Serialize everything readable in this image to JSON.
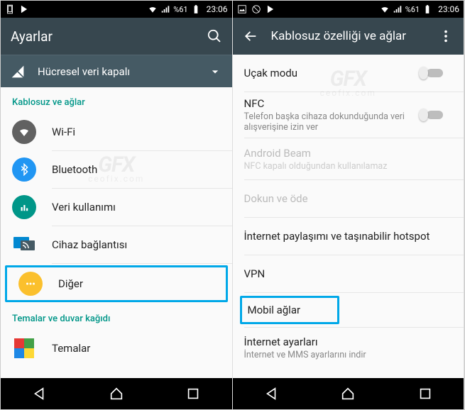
{
  "status": {
    "battery": "%61",
    "time": "23:06"
  },
  "left": {
    "appbar_title": "Ayarlar",
    "subbar_title": "Hücresel veri kapalı",
    "section1": "Kablosuz ve ağlar",
    "items": [
      {
        "label": "Wi-Fi",
        "icon": "wifi",
        "color": "#616161"
      },
      {
        "label": "Bluetooth",
        "icon": "bluetooth",
        "color": "#2196f3"
      },
      {
        "label": "Veri kullanımı",
        "icon": "data",
        "color": "#009688"
      },
      {
        "label": "Cihaz bağlantısı",
        "icon": "cast",
        "color": "none"
      },
      {
        "label": "Diğer",
        "icon": "more",
        "color": "#fbc02d"
      }
    ],
    "section2": "Temalar ve duvar kağıdı",
    "themes_label": "Temalar"
  },
  "right": {
    "appbar_title": "Kablosuz özelliği ve ağlar",
    "rows": [
      {
        "label": "Uçak modu",
        "toggle": true
      },
      {
        "label": "NFC",
        "sub": "Telefon başka cihaza dokunduğunda veri alışverişine izin ver",
        "toggle": true
      },
      {
        "label": "Android Beam",
        "sub": "NFC kapalı olduğundan kullanılamaz",
        "disabled": true
      },
      {
        "label": "Dokun ve öde",
        "disabled": true
      },
      {
        "label": "İnternet paylaşımı ve taşınabilir hotspot"
      },
      {
        "label": "VPN"
      },
      {
        "label": "Mobil ağlar",
        "highlight": true
      },
      {
        "label": "İnternet ayarları",
        "sub": "İnternet ve MMS ayarlarını indir"
      }
    ]
  },
  "watermark": {
    "big": "GFX",
    "small": "ceofix.com"
  }
}
